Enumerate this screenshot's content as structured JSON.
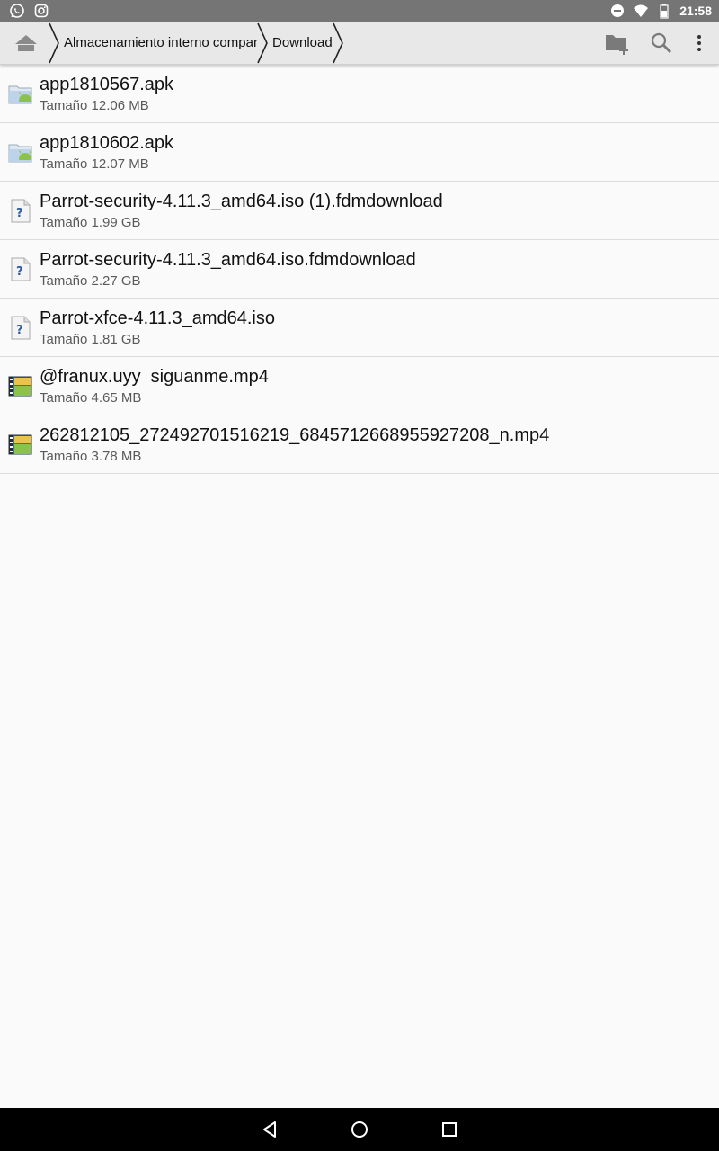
{
  "status_bar": {
    "time": "21:58",
    "left_icons": [
      "whatsapp-icon",
      "instagram-icon"
    ],
    "right_icons": [
      "do-not-disturb-icon",
      "wifi-icon",
      "battery-icon"
    ]
  },
  "toolbar": {
    "breadcrumbs": [
      "Almacenamiento interno compartido",
      "Download"
    ],
    "actions": [
      "new-folder-icon",
      "search-icon",
      "more-options-icon"
    ]
  },
  "files": [
    {
      "name": "app1810567.apk",
      "size": "Tamaño 12.06 MB",
      "type": "apk"
    },
    {
      "name": "app1810602.apk",
      "size": "Tamaño 12.07 MB",
      "type": "apk"
    },
    {
      "name": "Parrot-security-4.11.3_amd64.iso (1).fdmdownload",
      "size": "Tamaño 1.99 GB",
      "type": "unknown"
    },
    {
      "name": "Parrot-security-4.11.3_amd64.iso.fdmdownload",
      "size": "Tamaño 2.27 GB",
      "type": "unknown"
    },
    {
      "name": "Parrot-xfce-4.11.3_amd64.iso",
      "size": "Tamaño 1.81 GB",
      "type": "unknown"
    },
    {
      "name": "@franux.uyy  siguanme.mp4",
      "size": "Tamaño 4.65 MB",
      "type": "video"
    },
    {
      "name": "262812105_272492701516219_6845712668955927208_n.mp4",
      "size": "Tamaño 3.78 MB",
      "type": "video"
    }
  ],
  "colors": {
    "status_bar": "#757575",
    "toolbar": "#e8e8e8",
    "background": "#fafafa",
    "apk_green": "#8bc34a",
    "navbar": "#000000"
  }
}
